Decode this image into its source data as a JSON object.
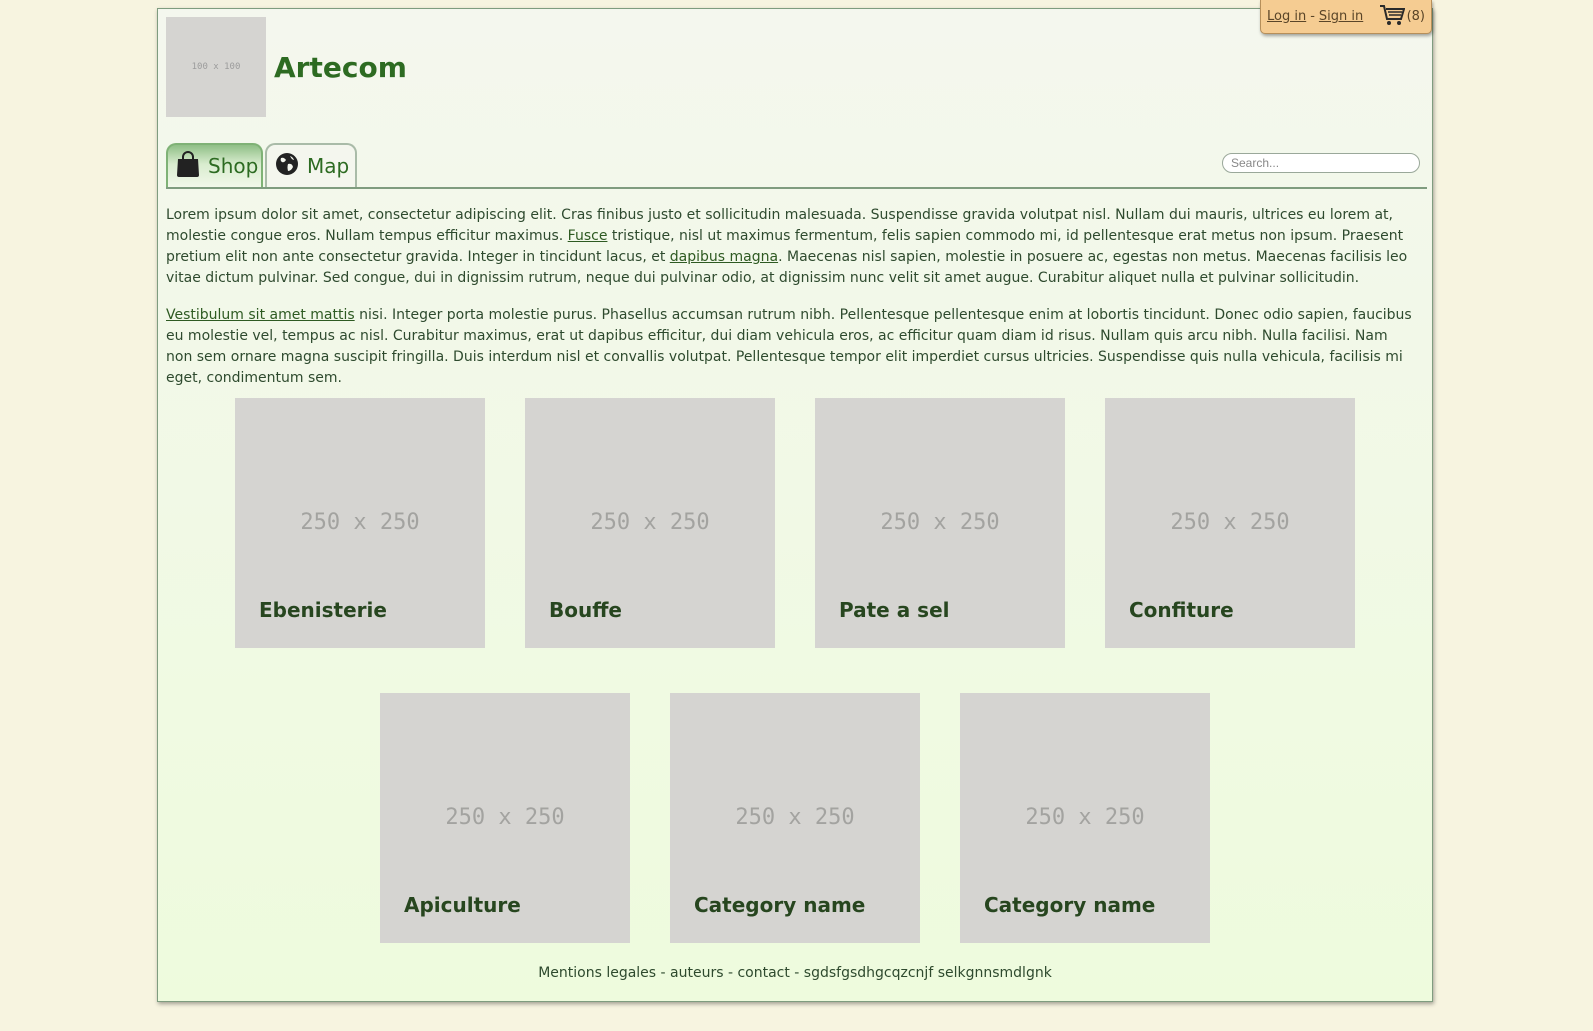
{
  "user_bar": {
    "login_label": "Log in",
    "separator": "-",
    "signin_label": "Sign in",
    "cart_count": "(8)",
    "cart_icon": "shopping-cart-icon"
  },
  "header": {
    "logo_placeholder": "100 x 100",
    "site_title": "Artecom"
  },
  "nav": {
    "tabs": [
      {
        "label": "Shop",
        "icon": "shopping-bag-icon",
        "active": true
      },
      {
        "label": "Map",
        "icon": "globe-icon",
        "active": false
      }
    ],
    "search_placeholder": "Search..."
  },
  "intro": {
    "p1_a": "Lorem ipsum dolor sit amet, consectetur adipiscing elit. Cras finibus justo et sollicitudin malesuada. Suspendisse gravida volutpat nisl. Nullam dui mauris, ultrices eu lorem at, molestie congue eros. Nullam tempus efficitur maximus. ",
    "p1_link1": "Fusce",
    "p1_b": " tristique, nisl ut maximus fermentum, felis sapien commodo mi, id pellentesque erat metus non ipsum. Praesent pretium elit non ante consectetur gravida. Integer in tincidunt lacus, et ",
    "p1_link2": "dapibus magna",
    "p1_c": ". Maecenas nisl sapien, molestie in posuere ac, egestas non metus. Maecenas facilisis leo vitae dictum pulvinar. Sed congue, dui in dignissim rutrum, neque dui pulvinar odio, at dignissim nunc velit sit amet augue. Curabitur aliquet nulla et pulvinar sollicitudin.",
    "p2_link": "Vestibulum sit amet mattis",
    "p2_a": " nisi. Integer porta molestie purus. Phasellus accumsan rutrum nibh. Pellentesque pellentesque enim at lobortis tincidunt. Donec odio sapien, faucibus eu molestie vel, tempus ac nisl. Curabitur maximus, erat ut dapibus efficitur, dui diam vehicula eros, ac efficitur quam diam id risus. Nullam quis arcu nibh. Nulla facilisi. Nam non sem ornare magna suscipit fringilla. Duis interdum nisl et convallis volutpat. Pellentesque tempor elit imperdiet cursus ultricies. Suspendisse quis nulla vehicula, facilisis mi eget, condimentum sem."
  },
  "categories": [
    {
      "name": "Ebenisterie",
      "image_placeholder": "250 x 250"
    },
    {
      "name": "Bouffe",
      "image_placeholder": "250 x 250"
    },
    {
      "name": "Pate a sel",
      "image_placeholder": "250 x 250"
    },
    {
      "name": "Confiture",
      "image_placeholder": "250 x 250"
    },
    {
      "name": "Apiculture",
      "image_placeholder": "250 x 250"
    },
    {
      "name": "Category name",
      "image_placeholder": "250 x 250"
    },
    {
      "name": "Category name",
      "image_placeholder": "250 x 250"
    }
  ],
  "footer": {
    "text": "Mentions legales - auteurs - contact - sgdsfgsdhgcqzcnjf selkgnnsmdlgnk"
  },
  "colors": {
    "page_background": "#f7f4e0",
    "accent_green": "#2d6b22",
    "user_bar_background": "#f5cc92",
    "placeholder_gray": "#d5d4d1"
  }
}
